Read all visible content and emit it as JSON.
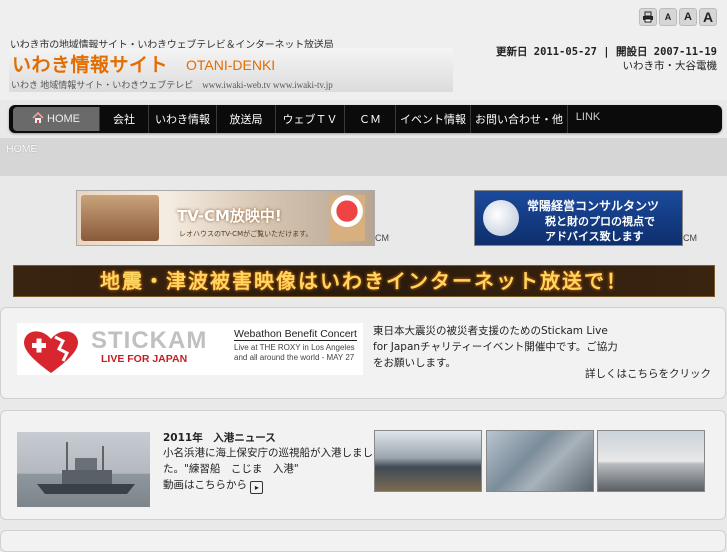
{
  "header": {
    "tagline": "いわき市の地域情報サイト・いわきウェブテレビ＆インターネット放送局",
    "site_title": "いわき情報サイト",
    "site_title_en": "OTANI-DENKI",
    "site_subtitle": "いわき 地域情報サイト・いわきウェブテレビ　www.iwaki-web.tv  www.iwaki-tv.jp",
    "dates": "更新日 2011-05-27 | 開設日 2007-11-19",
    "sub_date": "いわき市・大谷電機",
    "font_buttons": [
      "print",
      "A",
      "A",
      "A"
    ]
  },
  "nav": {
    "items": [
      {
        "label": "HOME",
        "icon": "home-icon"
      },
      {
        "label": "会社"
      },
      {
        "label": "いわき情報"
      },
      {
        "label": "放送局"
      },
      {
        "label": "ウェブＴＶ"
      },
      {
        "label": "ＣＭ"
      },
      {
        "label": "イベント情報"
      },
      {
        "label": "お問い合わせ・他"
      },
      {
        "label": "LINK"
      }
    ]
  },
  "breadcrumb": "HOME",
  "banners": {
    "ad1_text": "TV-CM放映中!",
    "ad1_sub": "レオハウスのTV-CMがご覧いただけます。",
    "ad1_cm": "CM",
    "ad2_title": "常陽経営コンサルタンツ",
    "ad2_text1": "税と財のプロの視点で",
    "ad2_text2": "アドバイス致します",
    "ad2_cm": "CM",
    "quake": "地震・津波被害映像はいわきインターネット放送で！"
  },
  "panel1": {
    "logo_title": "STICKAM",
    "logo_sub": "LIVE FOR JAPAN",
    "box_title": "Webathon Benefit Concert",
    "box_sub": "Live at THE ROXY in Los Angeles and all around the world - MAY 27",
    "text": "東日本大震災の被災者支援のためのStickam Live for Japanチャリティーイベント開催中です。ご協力をお願いします。",
    "more": "詳しくはこちらをクリック"
  },
  "panel2": {
    "title": "2011年　入港ニュース",
    "text": "小名浜港に海上保安庁の巡視船が入港しました。\"練習船　こじま　入港\"",
    "more": "動画はこちらから"
  }
}
